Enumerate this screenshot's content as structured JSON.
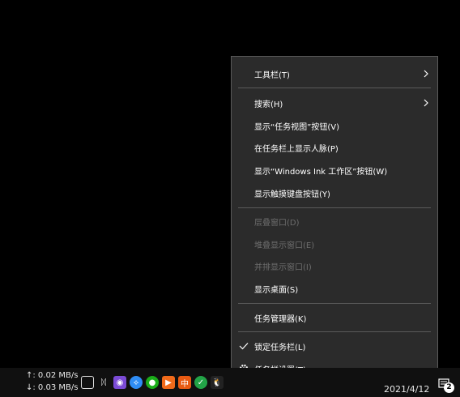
{
  "context_menu": {
    "toolbars": "工具栏(T)",
    "search": "搜索(H)",
    "show_task_view": "显示“任务视图”按钮(V)",
    "show_people": "在任务栏上显示人脉(P)",
    "show_ink_workspace": "显示“Windows Ink 工作区”按钮(W)",
    "show_touch_keyboard": "显示触摸键盘按钮(Y)",
    "cascade": "层叠窗口(D)",
    "stacked": "堆叠显示窗口(E)",
    "side_by_side": "并排显示窗口(I)",
    "show_desktop": "显示桌面(S)",
    "task_manager": "任务管理器(K)",
    "lock_taskbar": "锁定任务栏(L)",
    "taskbar_settings": "任务栏设置(T)"
  },
  "taskbar": {
    "net_up": "↑: 0.02 MB/s",
    "net_down": "↓: 0.03 MB/s",
    "date": "2021/4/12",
    "notification_count": "2",
    "tray_icons": [
      {
        "name": "task-view-icon",
        "color": "#3a3a3a"
      },
      {
        "name": "link-icon",
        "color": "#3a3a3a"
      },
      {
        "name": "app-icon",
        "color": "#7b4bd6"
      },
      {
        "name": "browser-icon",
        "color": "#2f8df5"
      },
      {
        "name": "wechat-icon",
        "color": "#1aad19"
      },
      {
        "name": "orange-app-icon",
        "color": "#f06a1a"
      },
      {
        "name": "ime-icon",
        "color": "#e85a12"
      },
      {
        "name": "shield-icon",
        "color": "#22a447"
      },
      {
        "name": "qq-icon",
        "color": "#222222"
      }
    ]
  }
}
